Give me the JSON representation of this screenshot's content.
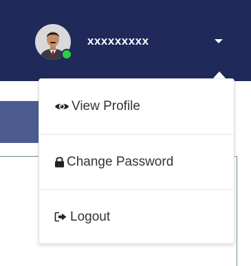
{
  "header": {
    "user_name": "xxxxxxxxx",
    "status": "online"
  },
  "colors": {
    "navbar": "#1f2a5a",
    "status_online": "#2ecc40",
    "content_bar": "#4d5c90",
    "menu_text": "#333333"
  },
  "menu": {
    "items": [
      {
        "label": "View Profile",
        "icon": "eye-icon"
      },
      {
        "label": "Change Password",
        "icon": "lock-icon"
      },
      {
        "label": "Logout",
        "icon": "sign-out-icon"
      }
    ]
  }
}
